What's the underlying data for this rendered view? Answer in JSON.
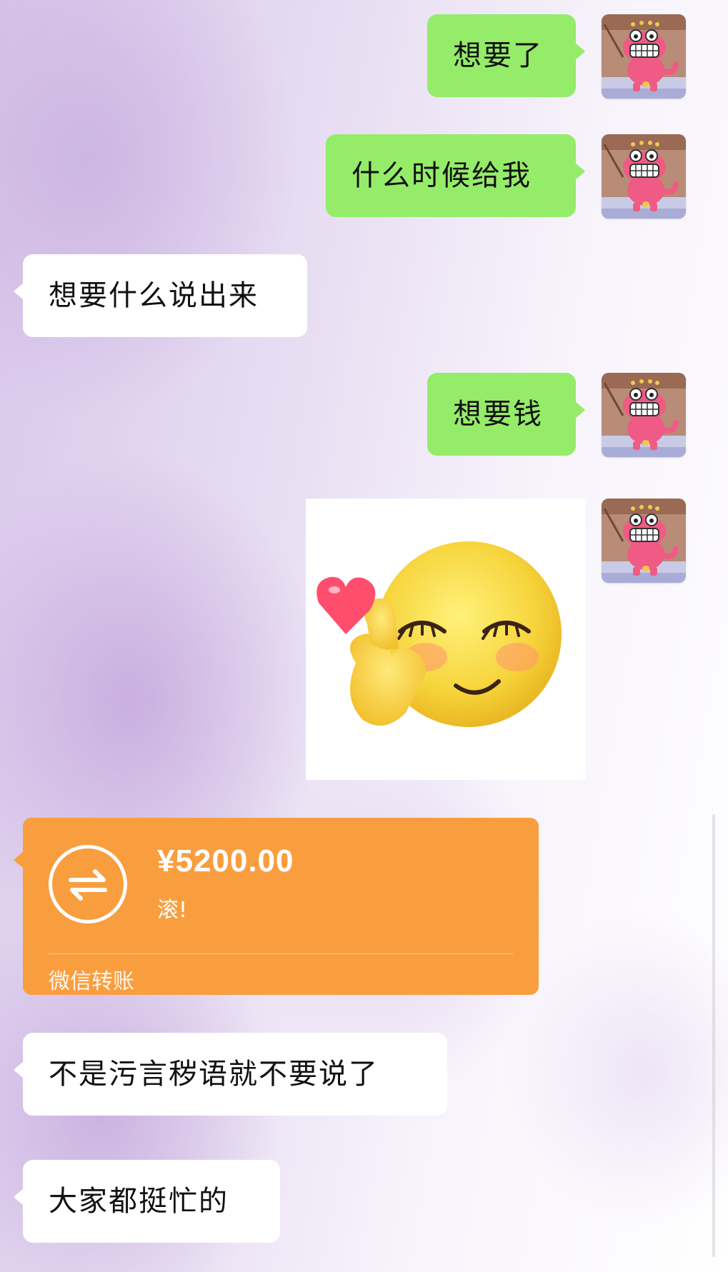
{
  "messages": [
    {
      "side": "right",
      "text": "想要了"
    },
    {
      "side": "right",
      "text": "什么时候给我"
    },
    {
      "side": "left",
      "text": "想要什么说出来"
    },
    {
      "side": "right",
      "text": "想要钱"
    },
    {
      "side": "right",
      "type": "sticker",
      "sticker_icon": "blushing-finger-heart-emoji"
    },
    {
      "side": "left",
      "type": "transfer"
    },
    {
      "side": "left",
      "text": "不是污言秽语就不要说了"
    },
    {
      "side": "left",
      "text": "大家都挺忙的"
    }
  ],
  "transfer": {
    "amount": "¥5200.00",
    "note": "滚!",
    "label": "微信转账",
    "icon": "transfer-arrows-icon"
  },
  "avatar_icon": "pink-dinosaur-avatar",
  "colors": {
    "sent_bubble": "#95ec69",
    "received_bubble": "#ffffff",
    "transfer_card": "#f99e3f"
  }
}
